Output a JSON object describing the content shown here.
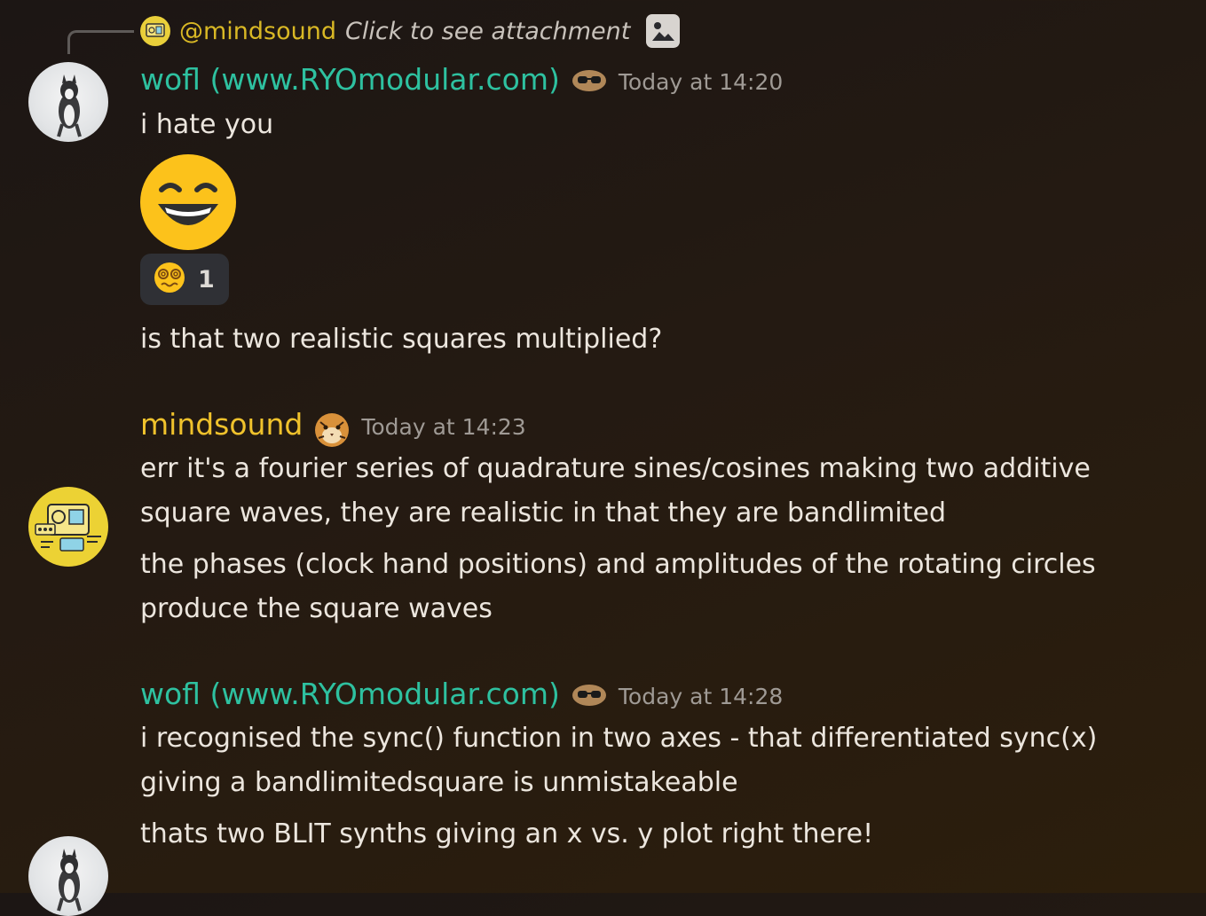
{
  "reply": {
    "name": "@mindsound",
    "text": "Click to see attachment",
    "avatar_icon": "mindsound-avatar",
    "attachment_icon": "image-icon"
  },
  "messages": [
    {
      "author": "wofl (www.RYOmodular.com)",
      "author_color": "#2ec1a0",
      "timestamp": "Today at 14:20",
      "lines": [
        "i hate you"
      ],
      "big_emoji": "grinning-squinting-face",
      "reaction": {
        "emoji": "dizzy-face",
        "count": "1"
      },
      "followup": [
        "is that two realistic squares multiplied?"
      ]
    },
    {
      "author": "mindsound",
      "author_color": "#f0c22c",
      "timestamp": "Today at 14:23",
      "lines": [
        "err it's a fourier series of quadrature sines/cosines making two additive",
        "square waves, they are realistic in that they are bandlimited"
      ],
      "followup": [
        "the phases (clock hand positions) and amplitudes of the rotating circles",
        "produce the square waves"
      ]
    },
    {
      "author": "wofl (www.RYOmodular.com)",
      "author_color": "#2ec1a0",
      "timestamp": "Today at 14:28",
      "lines": [
        "i recognised the sync() function in two axes - that differentiated sync(x)",
        "giving a bandlimitedsquare is unmistakeable"
      ],
      "followup": [
        "thats two BLIT synths giving an x vs. y plot right there!"
      ]
    }
  ]
}
